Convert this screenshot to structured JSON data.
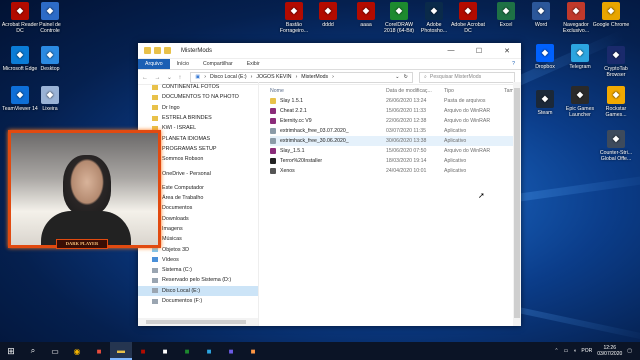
{
  "desktop_left": [
    {
      "label": "Acrobat Reader DC",
      "icon": "acrobat-reader-icon",
      "color": "#b30b00"
    },
    {
      "label": "Painel de Controle",
      "icon": "control-panel-icon",
      "color": "#2d6bc7"
    },
    {
      "label": "Microsoft Edge",
      "icon": "edge-icon",
      "color": "#0b7cd6"
    },
    {
      "label": "Desktop",
      "icon": "folder-icon",
      "color": "#2b8ae2"
    },
    {
      "label": "TeamViewer 14",
      "icon": "teamviewer-icon",
      "color": "#0e6fd8"
    },
    {
      "label": "Lixeira",
      "icon": "recycle-bin-icon",
      "color": "#9ab3d6"
    }
  ],
  "desktop_top": [
    {
      "label": "Bastão Forrageiro...",
      "icon": "pdf-icon",
      "color": "#b30b00"
    },
    {
      "label": "dddd",
      "icon": "pdf-icon",
      "color": "#b30b00"
    },
    {
      "label": "aaaa",
      "icon": "pdf-icon",
      "color": "#b30b00"
    },
    {
      "label": "CorelDRAW 2018 (64-Bit)",
      "icon": "coreldraw-icon",
      "color": "#1d8a2f"
    },
    {
      "label": "Adobe Photosho...",
      "icon": "photoshop-icon",
      "color": "#0a2a4a"
    },
    {
      "label": "Adobe Acrobat DC",
      "icon": "acrobat-icon",
      "color": "#b30b00"
    },
    {
      "label": "Excel",
      "icon": "excel-icon",
      "color": "#1e7145"
    },
    {
      "label": "Word",
      "icon": "word-icon",
      "color": "#2b579a"
    },
    {
      "label": "Navegador Exclusivo...",
      "icon": "browser-icon",
      "color": "#c0392b"
    },
    {
      "label": "Google Chrome",
      "icon": "chrome-icon",
      "color": "#e8a500"
    }
  ],
  "desktop_right": [
    {
      "label": "Dropbox",
      "icon": "dropbox-icon",
      "color": "#0061fe"
    },
    {
      "label": "Telegram",
      "icon": "telegram-icon",
      "color": "#2ca5e0"
    },
    {
      "label": "CryptoTab Browser",
      "icon": "cryptotab-icon",
      "color": "#1a2a6c"
    },
    {
      "label": "Steam",
      "icon": "steam-icon",
      "color": "#1b2838"
    },
    {
      "label": "Epic Games Launcher",
      "icon": "epic-games-icon",
      "color": "#2a2a2a"
    },
    {
      "label": "Rockstar Games...",
      "icon": "rockstar-icon",
      "color": "#f2a900"
    },
    {
      "label": "Counter-Stri... Global Offe...",
      "icon": "csgo-icon",
      "color": "#3d4a5c"
    }
  ],
  "window": {
    "title": "MisterMods",
    "minimize": "—",
    "maximize": "☐",
    "close": "✕",
    "tabs": [
      "Arquivo",
      "Início",
      "Compartilhar",
      "Exibir"
    ],
    "help": "?",
    "path": [
      "Este Computador",
      "Disco Local (E:)",
      "JOGOS KEVIN",
      "MisterMods"
    ],
    "search_placeholder": "Pesquisar MisterMods"
  },
  "nav_items": [
    {
      "label": "CONTINENTAL FOTOS",
      "kind": "folder"
    },
    {
      "label": "DOCUMENTOS TO NA PHOTO",
      "kind": "folder"
    },
    {
      "label": "Dr Ingo",
      "kind": "folder"
    },
    {
      "label": "ESTRELA BRINDES",
      "kind": "folder"
    },
    {
      "label": "KWI - ISRAEL",
      "kind": "folder"
    },
    {
      "label": "PLANETA IDIOMAS",
      "kind": "folder"
    },
    {
      "label": "PROGRAMAS SETUP",
      "kind": "folder"
    },
    {
      "label": "Sommos Robson",
      "kind": "folder"
    },
    {
      "label": "",
      "kind": "spacer"
    },
    {
      "label": "OneDrive - Personal",
      "kind": "cloud"
    },
    {
      "label": "",
      "kind": "spacer"
    },
    {
      "label": "Este Computador",
      "kind": "pc"
    },
    {
      "label": "Área de Trabalho",
      "kind": "desktop"
    },
    {
      "label": "Documentos",
      "kind": "docs"
    },
    {
      "label": "Downloads",
      "kind": "downloads"
    },
    {
      "label": "Imagens",
      "kind": "images"
    },
    {
      "label": "Músicas",
      "kind": "music"
    },
    {
      "label": "Objetos 3D",
      "kind": "objects"
    },
    {
      "label": "Vídeos",
      "kind": "videos"
    },
    {
      "label": "Sistema (C:)",
      "kind": "drive"
    },
    {
      "label": "Reservado pelo Sistema (D:)",
      "kind": "drive"
    },
    {
      "label": "Disco Local (E:)",
      "kind": "drive",
      "selected": true
    },
    {
      "label": "Documentos (F:)",
      "kind": "drive"
    }
  ],
  "columns": [
    "Nome",
    "Data de modificaç...",
    "Tipo",
    "Tam"
  ],
  "files": [
    {
      "name": "Slay 1.5.1",
      "date": "26/06/2020 13:24",
      "type": "Pasta de arquivos",
      "kind": "folder"
    },
    {
      "name": "Cheat 2.2.1",
      "date": "15/06/2020 11:33",
      "type": "Arquivo do WinRAR",
      "kind": "rar"
    },
    {
      "name": "Eternity.cc V9",
      "date": "22/06/2020 12:38",
      "type": "Arquivo do WinRAR",
      "kind": "rar"
    },
    {
      "name": "extrimhack_free_03.07.2020_",
      "date": "03/07/2020 11:35",
      "type": "Aplicativo",
      "kind": "app"
    },
    {
      "name": "extrimhack_free_30.06.2020_",
      "date": "30/06/2020 13:38",
      "type": "Aplicativo",
      "kind": "app",
      "highlight": true
    },
    {
      "name": "Slay_1.5.1",
      "date": "15/06/2020 07:50",
      "type": "Arquivo do WinRAR",
      "kind": "rar"
    },
    {
      "name": "Terror%20Installer",
      "date": "18/03/2020 19:14",
      "type": "Aplicativo",
      "kind": "app-dark"
    },
    {
      "name": "Xenos",
      "date": "24/04/2020 10:01",
      "type": "Aplicativo",
      "kind": "app-x"
    }
  ],
  "webcam": {
    "label": "DARK PLAYER"
  },
  "taskbar": {
    "apps": [
      "search-icon",
      "task-view-icon",
      "chrome-icon",
      "taskbar-app",
      "explorer-icon",
      "taskbar-app",
      "taskbar-app",
      "taskbar-app",
      "taskbar-app",
      "taskbar-app",
      "taskbar-app"
    ],
    "tray_lang": "POR",
    "time": "12:26",
    "date": "03/07/2020"
  }
}
